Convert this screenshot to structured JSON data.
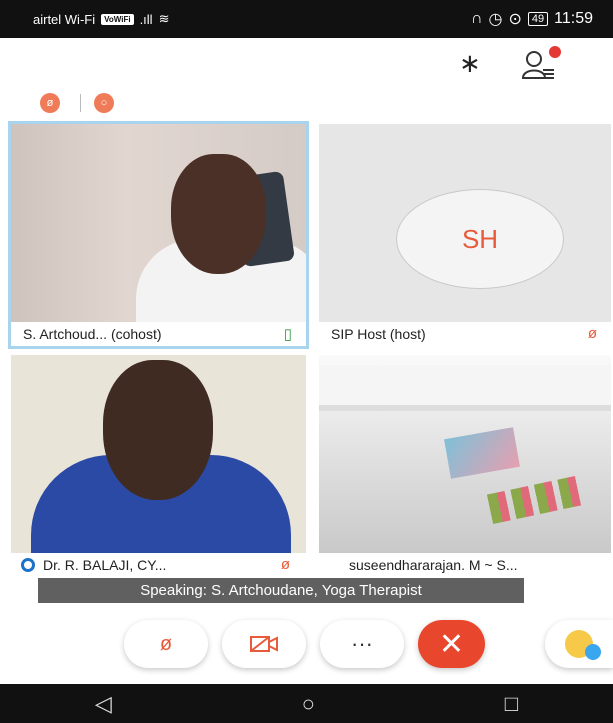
{
  "status_bar": {
    "carrier": "airtel Wi-Fi",
    "vowifi": "VoWiFi",
    "battery": "49",
    "time": "11:59"
  },
  "toolbar": {
    "bluetooth_icon": "bluetooth-icon",
    "participants_icon": "participants-icon"
  },
  "indicators": {
    "mic_off": "ø",
    "recording": "○"
  },
  "tiles": [
    {
      "name": "S. Artchoud... (cohost)",
      "mic_icon": "mic-on-icon",
      "mic_glyph": "▯",
      "mic_color": "#2e9b3c"
    },
    {
      "name": "SIP Host (host)",
      "avatar": "SH",
      "mic_icon": "mic-off-icon",
      "mic_glyph": "ø",
      "mic_color": "#e85a3a"
    },
    {
      "name": "Dr. R. BALAJI, CY...",
      "mic_icon": "mic-off-icon",
      "mic_glyph": "ø",
      "mic_color": "#e85a3a"
    },
    {
      "name": "suseendhararajan. M ~ S..."
    }
  ],
  "speaking": "Speaking: S. Artchoudane, Yoga Therapist",
  "controls": {
    "mute": "ø",
    "video": "▭",
    "more": "···",
    "end": "✕"
  },
  "navbar": {
    "back": "◁",
    "home": "○",
    "recents": "□"
  },
  "colors": {
    "accent": "#e85a3a",
    "end_call": "#e8472e",
    "active_speaker": "#a9d4ee"
  }
}
